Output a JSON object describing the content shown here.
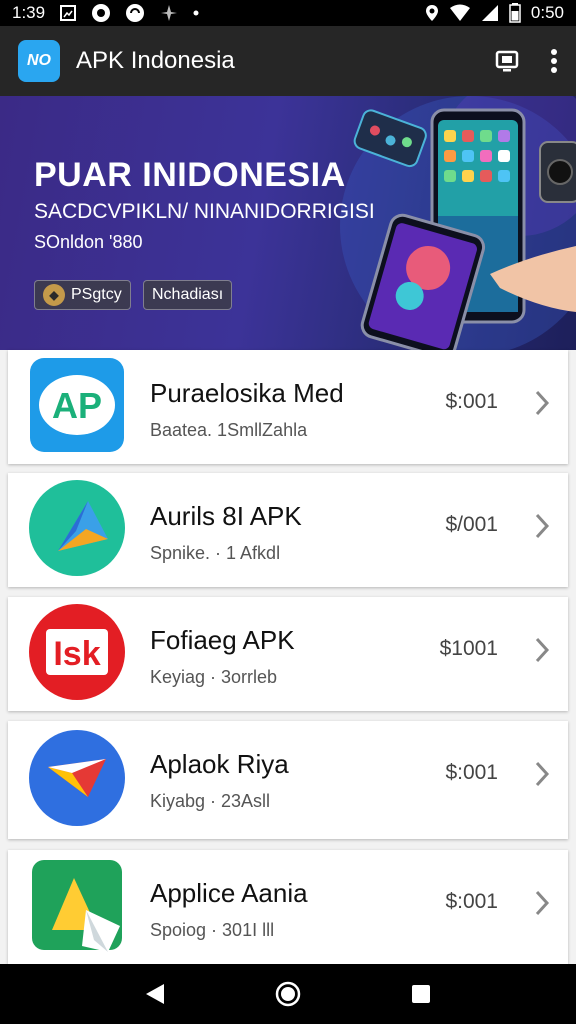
{
  "status_bar": {
    "time": "1:39",
    "battery_text": "0:50"
  },
  "app_bar": {
    "logo_text": "NO",
    "title": "APK Indonesia"
  },
  "banner": {
    "title": "PUAR INIDONESIA",
    "subtitle": "SACDCVPIKLN/ NINANIDORRIGISI",
    "tagline": "SOnldon '880",
    "badges": [
      {
        "label": "PSgtcy"
      },
      {
        "label": "Nchadiası"
      }
    ]
  },
  "apps": [
    {
      "name": "Puraelosika Med",
      "meta": "Baatea. 1SmllZahla",
      "price": "$:001",
      "icon": "ap-icon",
      "icon_text": "AP"
    },
    {
      "name": "Aurils 8I APK",
      "meta": "Spnike. · 1 Afkdl",
      "price": "$/001",
      "icon": "play-arrow-icon"
    },
    {
      "name": "Fofiaeg APK",
      "meta": "Keyiag · 3orrleb",
      "price": "$1001",
      "icon": "isk-icon",
      "icon_text": "Isk"
    },
    {
      "name": "Aplaok Riya",
      "meta": "Kiyabg · 23Asll",
      "price": "$:001",
      "icon": "envelope-arrow-icon"
    },
    {
      "name": "Applice Aania",
      "meta": "Spoiog · 301I lll",
      "price": "$:001",
      "icon": "folded-a-icon"
    }
  ],
  "colors": {
    "app_bar": "#262626",
    "banner_start": "#3b2a86",
    "banner_end": "#1d1f5a",
    "card": "#ffffff",
    "background": "#f2f2f2"
  }
}
